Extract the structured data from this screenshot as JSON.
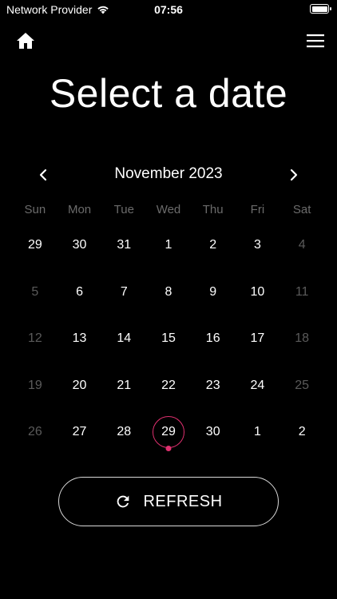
{
  "status_bar": {
    "carrier": "Network Provider",
    "time": "07:56"
  },
  "header": {
    "home_icon": "home-icon",
    "menu_icon": "hamburger-menu-icon"
  },
  "page": {
    "title": "Select a date"
  },
  "calendar": {
    "month_label": "November 2023",
    "prev_icon": "chevron-left-icon",
    "next_icon": "chevron-right-icon",
    "weekdays": [
      "Sun",
      "Mon",
      "Tue",
      "Wed",
      "Thu",
      "Fri",
      "Sat"
    ],
    "selected_day": "29",
    "accent_color": "#e0306f",
    "days": [
      {
        "label": "29",
        "muted": false
      },
      {
        "label": "30",
        "muted": false
      },
      {
        "label": "31",
        "muted": false
      },
      {
        "label": "1",
        "muted": false
      },
      {
        "label": "2",
        "muted": false
      },
      {
        "label": "3",
        "muted": false
      },
      {
        "label": "4",
        "muted": true
      },
      {
        "label": "5",
        "muted": true
      },
      {
        "label": "6",
        "muted": false
      },
      {
        "label": "7",
        "muted": false
      },
      {
        "label": "8",
        "muted": false
      },
      {
        "label": "9",
        "muted": false
      },
      {
        "label": "10",
        "muted": false
      },
      {
        "label": "11",
        "muted": true
      },
      {
        "label": "12",
        "muted": true
      },
      {
        "label": "13",
        "muted": false
      },
      {
        "label": "14",
        "muted": false
      },
      {
        "label": "15",
        "muted": false
      },
      {
        "label": "16",
        "muted": false
      },
      {
        "label": "17",
        "muted": false
      },
      {
        "label": "18",
        "muted": true
      },
      {
        "label": "19",
        "muted": true
      },
      {
        "label": "20",
        "muted": false
      },
      {
        "label": "21",
        "muted": false
      },
      {
        "label": "22",
        "muted": false
      },
      {
        "label": "23",
        "muted": false
      },
      {
        "label": "24",
        "muted": false
      },
      {
        "label": "25",
        "muted": true
      },
      {
        "label": "26",
        "muted": true
      },
      {
        "label": "27",
        "muted": false
      },
      {
        "label": "28",
        "muted": false
      },
      {
        "label": "29",
        "muted": false,
        "selected": true
      },
      {
        "label": "30",
        "muted": false
      },
      {
        "label": "1",
        "muted": false
      },
      {
        "label": "2",
        "muted": false
      }
    ]
  },
  "refresh_button": {
    "label": "REFRESH",
    "icon": "refresh-icon"
  }
}
